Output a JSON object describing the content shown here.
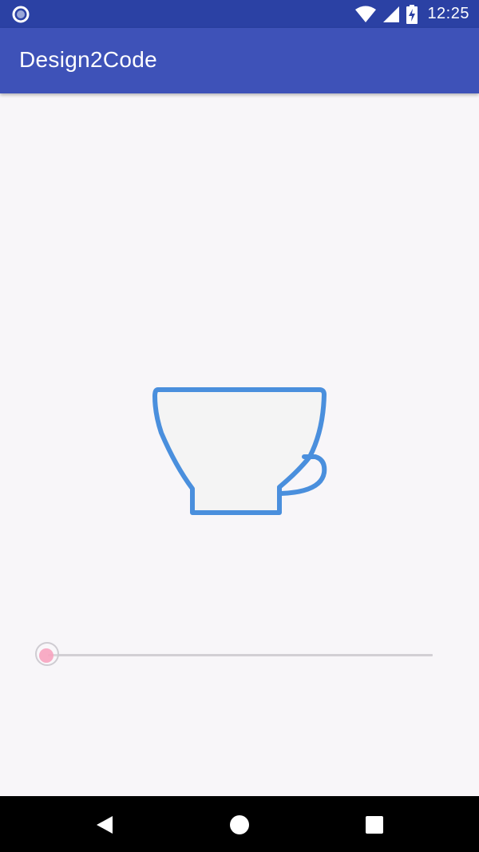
{
  "status_bar": {
    "time": "12:25",
    "left_icon": "circle-notification-icon",
    "icons": [
      "wifi-icon",
      "cell-signal-icon",
      "battery-charging-icon"
    ]
  },
  "app_bar": {
    "title": "Design2Code"
  },
  "main": {
    "illustration": "coffee-cup-icon",
    "slider": {
      "value": 0,
      "min": 0,
      "max": 100
    }
  },
  "nav_bar": {
    "buttons": [
      "back-icon",
      "home-icon",
      "recents-icon"
    ]
  },
  "colors": {
    "status_bar": "#2b41a4",
    "app_bar": "#3e52b8",
    "background": "#f8f6f9",
    "cup_stroke": "#4a8fdd",
    "slider_touch": "#f7a3bf",
    "slider_track": "#d2cfd4"
  }
}
